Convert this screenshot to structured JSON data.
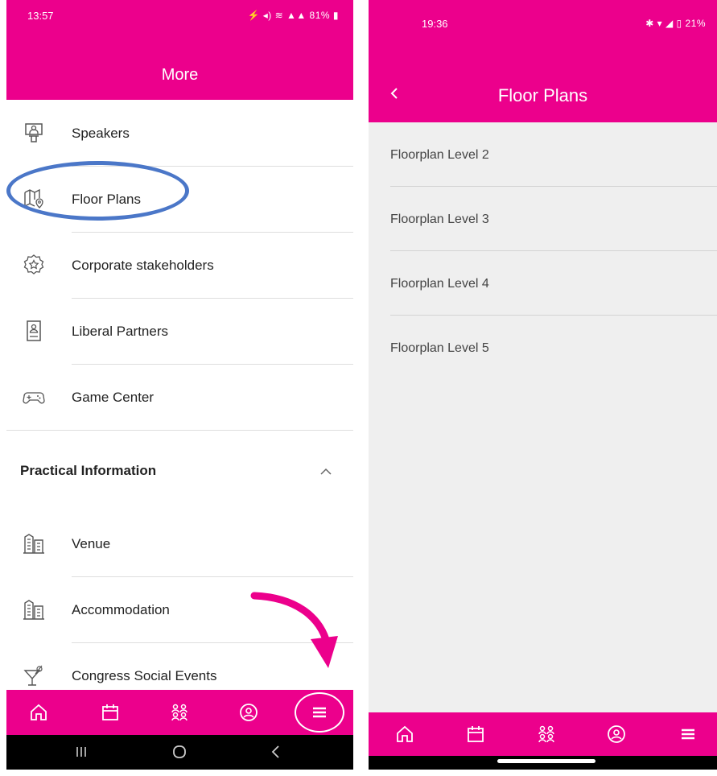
{
  "left_screen": {
    "status_bar": {
      "time": "13:57",
      "icons": "⚡ ◂) ≋ ▲▲ 81% ▮"
    },
    "title": "More",
    "menu_items": [
      {
        "label": "Speakers",
        "icon": "speaker-podium-icon"
      },
      {
        "label": "Floor Plans",
        "icon": "map-pin-icon"
      },
      {
        "label": "Corporate stakeholders",
        "icon": "star-badge-icon"
      },
      {
        "label": "Liberal Partners",
        "icon": "id-card-icon"
      },
      {
        "label": "Game Center",
        "icon": "gamepad-icon"
      }
    ],
    "section": {
      "title": "Practical Information",
      "expanded": true
    },
    "section_items": [
      {
        "label": "Venue",
        "icon": "buildings-icon"
      },
      {
        "label": "Accommodation",
        "icon": "buildings-icon"
      },
      {
        "label": "Congress Social Events",
        "icon": "cocktail-icon"
      }
    ],
    "bottom_nav": [
      "home-icon",
      "calendar-icon",
      "people-icon",
      "profile-icon",
      "menu-icon"
    ],
    "system_nav": [
      "recents-icon",
      "home-circle-icon",
      "back-icon"
    ]
  },
  "right_screen": {
    "status_bar": {
      "time": "19:36",
      "icons": "✱ ▾ ◢ ▯ 21%"
    },
    "title": "Floor Plans",
    "items": [
      {
        "label": "Floorplan Level 2"
      },
      {
        "label": "Floorplan Level 3"
      },
      {
        "label": "Floorplan Level 4"
      },
      {
        "label": "Floorplan Level 5"
      }
    ],
    "bottom_nav": [
      "home-icon",
      "calendar-icon",
      "people-icon",
      "profile-icon",
      "menu-icon"
    ]
  },
  "colors": {
    "brand": "#ec008c",
    "highlight": "#4b77c8",
    "list_bg": "#efefef"
  }
}
